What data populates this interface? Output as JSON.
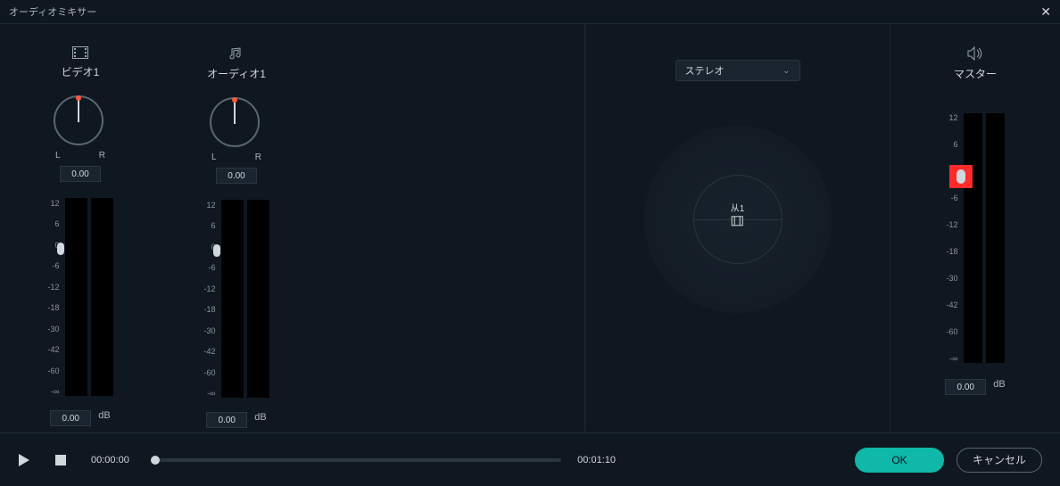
{
  "title": "オーディオミキサー",
  "channels": [
    {
      "label": "ビデオ1",
      "pan_value": "0.00",
      "gain_value": "0.00",
      "icon": "video"
    },
    {
      "label": "オーディオ1",
      "pan_value": "0.00",
      "gain_value": "0.00",
      "icon": "audio"
    }
  ],
  "pan_labels": {
    "left": "L",
    "right": "R"
  },
  "db_unit": "dB",
  "meter_scale": [
    "12",
    "6",
    "0",
    "-6",
    "-12",
    "-18",
    "-30",
    "-42",
    "-60",
    "-∞"
  ],
  "stereo_dropdown": {
    "selected": "ステレオ"
  },
  "surround_center": "从1",
  "master": {
    "label": "マスター",
    "gain_value": "0.00"
  },
  "master_scale": [
    "12",
    "6",
    "0",
    "-6",
    "-12",
    "-18",
    "-30",
    "-42",
    "-60",
    "-∞"
  ],
  "playback": {
    "current": "00:00:00",
    "total": "00:01:10"
  },
  "buttons": {
    "ok": "OK",
    "cancel": "キャンセル"
  }
}
